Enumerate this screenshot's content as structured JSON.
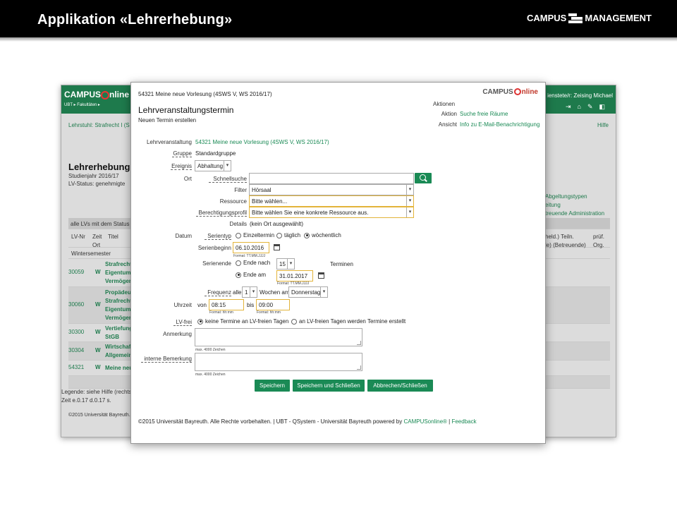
{
  "banner": {
    "title": "Applikation «Lehrerhebung»",
    "logo_left": "CAMPUS",
    "logo_right": "MANAGEMENT"
  },
  "bgapp": {
    "brand": "CAMPUS",
    "brand_suffix": "nline",
    "nav": "UBT ▸ Fakultäten ▸",
    "user": "ienstete/r: Zeising Michael",
    "crumb": "Lehrstuhl: Strafrecht I (S",
    "help": "Hilfe",
    "page_title": "Lehrerhebung",
    "studienjahr": "Studienjahr 2016/17",
    "lv_status": "LV-Status: genehmigte",
    "right_links": [
      "Abgeltungstypen",
      "eitung",
      "treuende  Administration"
    ],
    "filter_row": "alle LVs mit dem Status",
    "col_lvnr": "LV-Nr",
    "col_zeit": "Zeit",
    "col_ort": "Ort",
    "col_titel": "Titel",
    "col_right1": "held.) Teiln.",
    "col_right2": "le) (Betreuende)",
    "col_pruef1": "prüf.",
    "col_pruef2": "Org.",
    "semester": "Wintersemester",
    "rows": [
      {
        "nr": "30059",
        "type": "W",
        "title": [
          "Strafrecht",
          "Eigentums",
          "Vermögen"
        ]
      },
      {
        "nr": "30060",
        "type": "W",
        "title": [
          "Propädeu",
          "Strafrecht",
          "Eigentums",
          "Vermögen"
        ]
      },
      {
        "nr": "30300",
        "type": "W",
        "title": [
          "Vertiefung",
          "StGB"
        ]
      },
      {
        "nr": "30304",
        "type": "W",
        "title": [
          "Wirtschaft",
          "Allgemein"
        ]
      },
      {
        "nr": "54321",
        "type": "W",
        "title": [
          "Meine neu"
        ]
      }
    ],
    "legend": "Legende: siehe Hilfe (rechts",
    "zeit": "Zeit e.0.17 d.0.17 s.",
    "copyright": "©2015 Universität Bayreuth."
  },
  "dialog": {
    "top_crumb": "54321 Meine neue Vorlesung (4SWS V, WS 2016/17)",
    "logo": "CAMPUS",
    "logo_suffix": "nline",
    "aktionen_label": "Aktionen",
    "aktion_label": "Aktion",
    "aktion_value": "Suche freie Räume",
    "ansicht_label": "Ansicht",
    "ansicht_value": "Info zu E-Mail-Benachrichtigung",
    "title": "Lehrveranstaltungstermin",
    "subtitle": "Neuen Termin erstellen",
    "lv_label": "Lehrveranstaltung",
    "lv_value": "54321 Meine neue Vorlesung (4SWS V, WS 2016/17)",
    "gruppe_label": "Gruppe",
    "gruppe_value": "Standardgruppe",
    "ereignis_label": "Ereignis",
    "ereignis_value": "Abhaltung",
    "ort_label": "Ort",
    "schnellsuche_label": "Schnellsuche",
    "schnellsuche_value": "",
    "filter_label": "Filter",
    "filter_value": "Hörsaal",
    "ressource_label": "Ressource",
    "ressource_value": "Bitte wählen...",
    "berecht_label": "Berechtigungsprofil",
    "berecht_value": "Bitte wählen Sie eine konkrete Ressource aus.",
    "details_label": "Details",
    "details_value": "(kein Ort ausgewählt)",
    "datum_label": "Datum",
    "serientyp_label": "Serientyp",
    "serientyp_options": [
      "Einzeltermin",
      "täglich",
      "wöchentlich"
    ],
    "serienbeginn_label": "Serienbeginn",
    "serienbeginn_value": "06.10.2016",
    "date_format": "Format: TT.MM.JJJJ",
    "serienende_label": "Serienende",
    "ende_nach_label": "Ende nach",
    "ende_nach_value": "15",
    "termine_label": "Terminen",
    "ende_am_label": "Ende am",
    "ende_am_value": "31.01.2017",
    "frequenz_label": "Frequenz",
    "alle_label": "alle",
    "frequenz_value": "1",
    "wochen_am_label": "Wochen am",
    "wochentag_value": "Donnerstag",
    "uhrzeit_label": "Uhrzeit",
    "von_label": "von",
    "von_value": "08:15",
    "bis_label": "bis",
    "bis_value": "09:00",
    "time_format": "Format: hh:mm",
    "lvfrei_label": "LV-frei",
    "lvfrei_options": [
      "keine Termine an LV-freien Tagen",
      "an LV-freien Tagen werden Termine erstellt"
    ],
    "anmerkung_label": "Anmerkung",
    "interne_label": "interne Bemerkung",
    "max_chars": "max. 4000 Zeichen",
    "btn_save": "Speichern",
    "btn_save_close": "Speichern und Schließen",
    "btn_cancel": "Abbrechen/Schließen",
    "footer_text": "©2015 Universität Bayreuth. Alle Rechte vorbehalten. | UBT - QSystem - Universität Bayreuth powered by ",
    "footer_link1": "CAMPUSonline®",
    "footer_sep": " | ",
    "footer_link2": "Feedback"
  },
  "colors": {
    "accent_green": "#1a8a55",
    "header_green": "#1e7a4c",
    "highlight_yellow": "#e3b43a"
  }
}
